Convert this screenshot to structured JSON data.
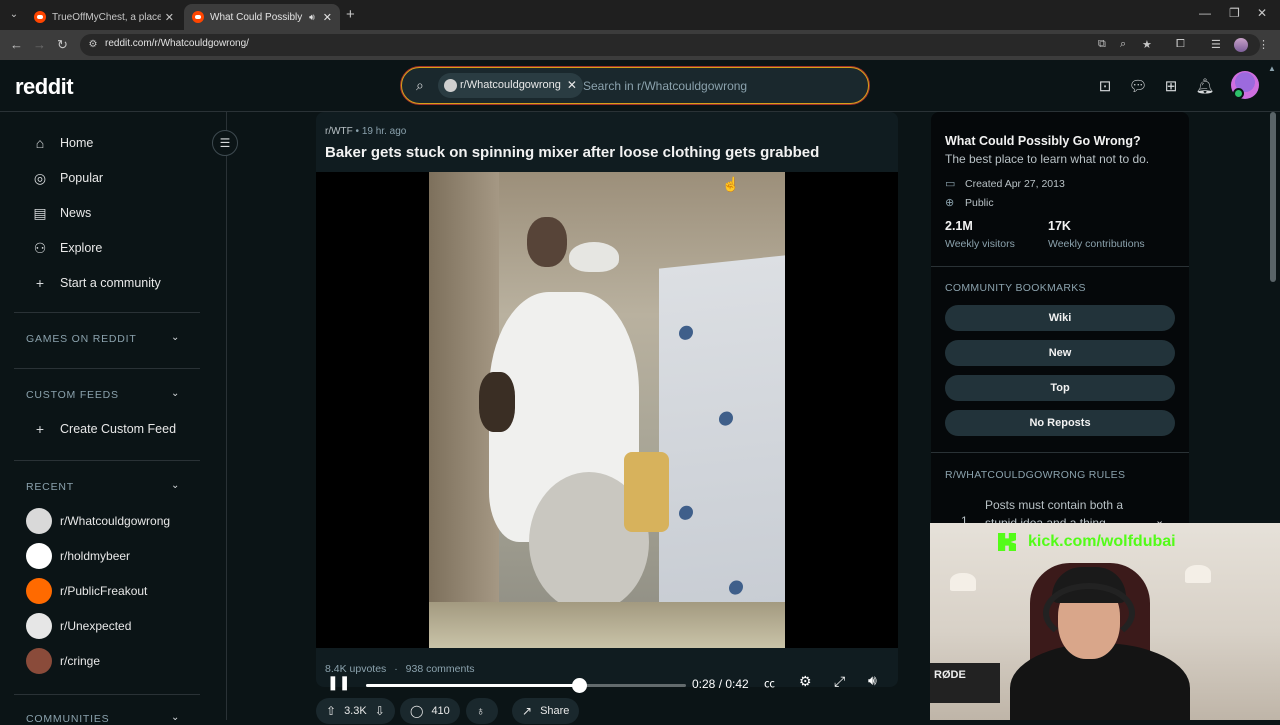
{
  "browser": {
    "tabs": [
      {
        "title": "TrueOffMyChest, a place for pe",
        "active": false
      },
      {
        "title": "What Could Possibly Go W",
        "active": true
      }
    ],
    "url": "reddit.com/r/Whatcouldgowrong/"
  },
  "header": {
    "logo": "reddit",
    "search_chip": "r/Whatcouldgowrong",
    "search_placeholder": "Search in r/Whatcouldgowrong"
  },
  "left_sidebar": {
    "nav": [
      {
        "label": "Home",
        "icon": "home-icon"
      },
      {
        "label": "Popular",
        "icon": "popular-icon"
      },
      {
        "label": "News",
        "icon": "news-icon"
      },
      {
        "label": "Explore",
        "icon": "explore-icon"
      },
      {
        "label": "Start a community",
        "icon": "plus-icon"
      }
    ],
    "sections": {
      "games": "GAMES ON REDDIT",
      "custom_feeds": "CUSTOM FEEDS",
      "create_custom_feed": "Create Custom Feed",
      "recent": "RECENT",
      "communities": "COMMUNITIES"
    },
    "recent": [
      {
        "name": "r/Whatcouldgowrong",
        "color": "#d9d9d9"
      },
      {
        "name": "r/holdmybeer",
        "color": "#ffffff"
      },
      {
        "name": "r/PublicFreakout",
        "color": "#ff6a00"
      },
      {
        "name": "r/Unexpected",
        "color": "#e6e6e6"
      },
      {
        "name": "r/cringe",
        "color": "#8a4b3a"
      }
    ]
  },
  "post": {
    "subreddit": "r/WTF",
    "separator": "•",
    "time": "19 hr. ago",
    "title": "Baker gets stuck on spinning mixer after loose clothing gets grabbed",
    "video": {
      "time_readout": "0:28 / 0:42",
      "progress": 0.667
    },
    "upvotes_text": "8.4K upvotes",
    "dot": "·",
    "comments_text": "938 comments",
    "actions": {
      "votes": "3.3K",
      "comments": "410",
      "share": "Share"
    }
  },
  "right_sidebar": {
    "name": "What Could Possibly Go Wrong?",
    "description": "The best place to learn what not to do.",
    "created": "Created Apr 27, 2013",
    "visibility": "Public",
    "stats": [
      {
        "value": "2.1M",
        "label": "Weekly visitors"
      },
      {
        "value": "17K",
        "label": "Weekly contributions"
      }
    ],
    "bookmarks_title": "COMMUNITY BOOKMARKS",
    "bookmarks": [
      "Wiki",
      "New",
      "Top",
      "No Reposts"
    ],
    "rules_title": "R/WHATCOULDGOWRONG RULES",
    "rules": [
      {
        "num": "1",
        "text": "Posts must contain both a stupid idea and a thing going"
      }
    ]
  },
  "overlay": {
    "kick_url": "kick.com/wolfdubai",
    "mic_brand": "RØDE",
    "kick_color": "#53fc18"
  },
  "colors": {
    "background": "#0b1416",
    "search_border": "#d4a01a",
    "reddit_orange": "#ff4500"
  }
}
